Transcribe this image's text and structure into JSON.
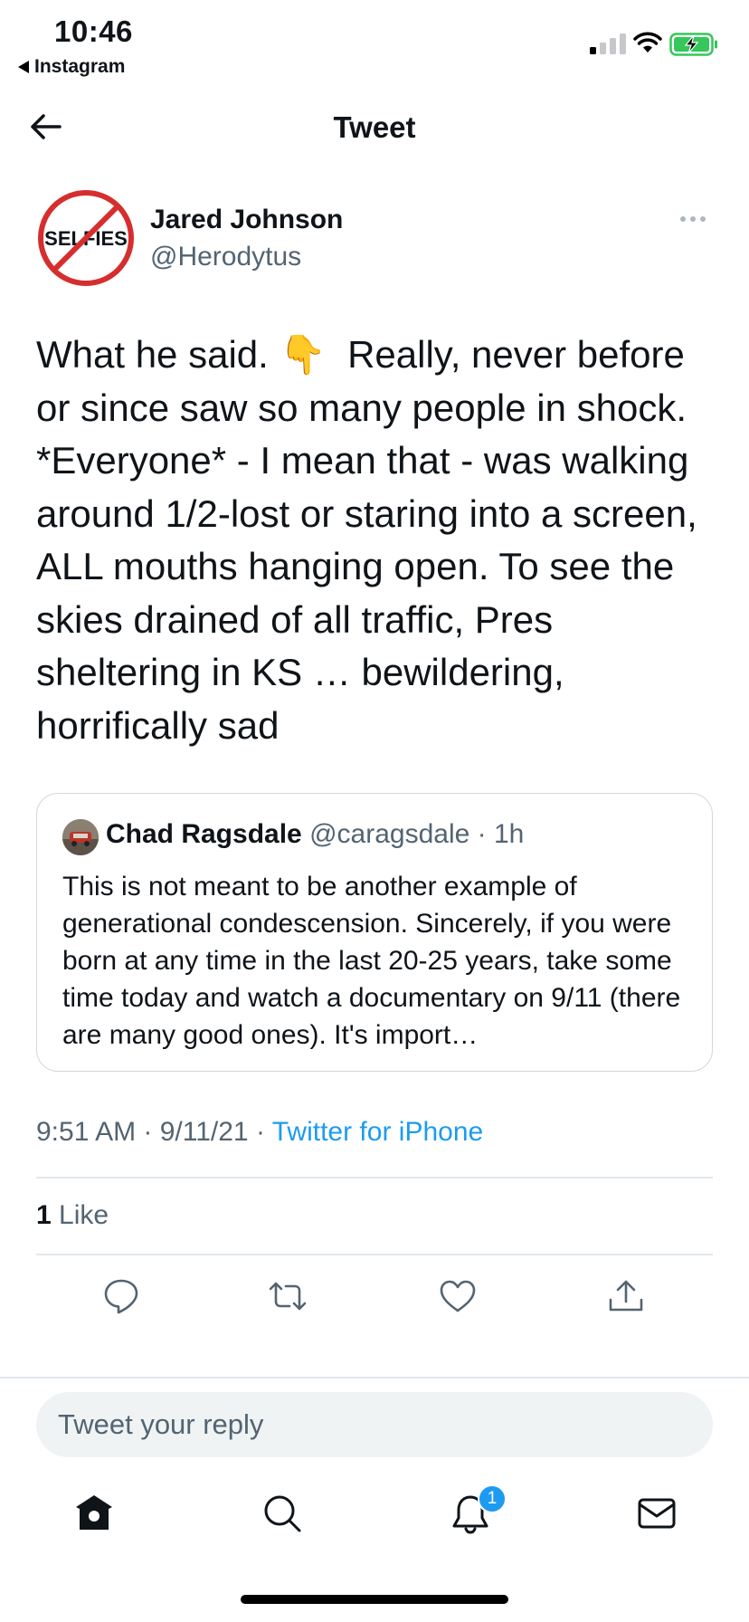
{
  "status_bar": {
    "time": "10:46",
    "back_app_label": "Instagram"
  },
  "header": {
    "title": "Tweet"
  },
  "tweet": {
    "author_name": "Jared Johnson",
    "author_handle": "@Herodytus",
    "avatar_text": "SELFIES",
    "text": "What he said. 👇  Really, never before or since saw so many people in shock.  *Everyone* - I mean that - was walking around 1/2-lost or staring into a screen, ALL mouths hanging open. To see the skies drained of all traffic, Pres sheltering in KS … bewildering, horrifically sad",
    "time": "9:51 AM",
    "date": "9/11/21",
    "source": "Twitter for iPhone",
    "like_count": "1",
    "like_label": "Like"
  },
  "quoted_tweet": {
    "author_name": "Chad Ragsdale",
    "author_handle": "@caragsdale",
    "age": "1h",
    "text": "This is not meant to be another example of generational condescension. Sincerely, if you were born at any time in the last 20-25 years, take some time today and watch a documentary on 9/11 (there are many good ones). It's import…"
  },
  "reply": {
    "placeholder": "Tweet your reply"
  },
  "tab_bar": {
    "items": [
      {
        "icon": "home-icon"
      },
      {
        "icon": "search-icon"
      },
      {
        "icon": "bell-icon"
      },
      {
        "icon": "mail-icon"
      }
    ],
    "notification_count": "1"
  },
  "colors": {
    "accent": "#1d9bf0",
    "secondary_text": "#536471",
    "divider": "#e1e8ed",
    "selfies_red": "#d62e2e"
  }
}
